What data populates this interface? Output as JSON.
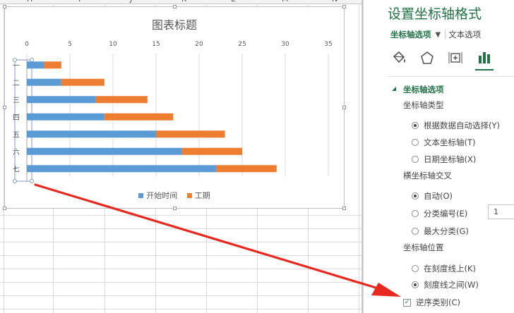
{
  "sheet": {
    "columns": [
      "H",
      "I",
      "J",
      "K",
      "L",
      "M",
      "N"
    ]
  },
  "chart": {
    "title": "图表标题",
    "chart_data": {
      "type": "bar",
      "orientation": "horizontal",
      "stacked": true,
      "categories": [
        "一",
        "二",
        "三",
        "四",
        "五",
        "六",
        "七"
      ],
      "series": [
        {
          "name": "开始时间",
          "values": [
            2,
            4,
            8,
            9,
            15,
            18,
            22
          ],
          "color": "#5b9bd5"
        },
        {
          "name": "工期",
          "values": [
            2,
            5,
            6,
            8,
            8,
            7,
            7
          ],
          "color": "#ed7d31"
        }
      ],
      "xlim": [
        0,
        35
      ],
      "xticks": [
        0,
        5,
        10,
        15,
        20,
        25,
        30,
        35
      ],
      "x_axis_position": "top",
      "categories_reversed": true,
      "grid": true,
      "legend": "bottom"
    }
  },
  "pane": {
    "title": "设置坐标轴格式",
    "tab_axis": "坐标轴选项",
    "tab_arrow": "▼",
    "tab_text": "文本选项",
    "icons": [
      "paint-bucket-icon",
      "pentagon-icon",
      "size-properties-icon",
      "bar-chart-icon"
    ],
    "section": "坐标轴选项",
    "section_arrow": "◢",
    "axis_type": {
      "label": "坐标轴类型",
      "options": [
        "根据数据自动选择(Y)",
        "文本坐标轴(T)",
        "日期坐标轴(X)"
      ],
      "selected": 0
    },
    "cross": {
      "label": "横坐标轴交叉",
      "options": [
        "自动(O)",
        "分类编号(E)",
        "最大分类(G)"
      ],
      "selected": 0,
      "number_value": "1"
    },
    "position": {
      "label": "坐标轴位置",
      "options": [
        "在刻度线上(K)",
        "刻度线之间(W)"
      ],
      "selected": 1
    },
    "reverse": {
      "label": "逆序类别(C)",
      "checked": true,
      "check_mark": "✓"
    }
  },
  "colors": {
    "accent": "#217346",
    "annotation_arrow": "#e8281e"
  }
}
